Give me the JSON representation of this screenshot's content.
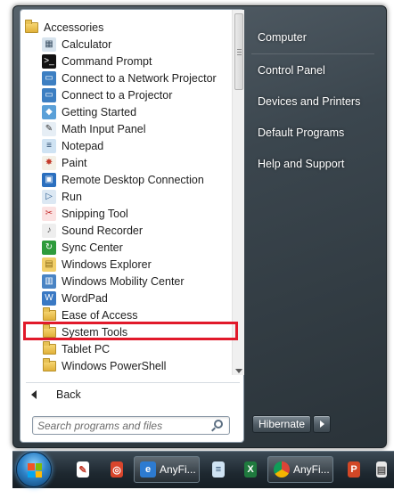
{
  "programs": [
    {
      "label": "Accessories",
      "icon": "folder-icon",
      "root": true
    },
    {
      "label": "Calculator",
      "icon": "calculator-icon"
    },
    {
      "label": "Command Prompt",
      "icon": "command-prompt-icon"
    },
    {
      "label": "Connect to a Network Projector",
      "icon": "network-projector-icon"
    },
    {
      "label": "Connect to a Projector",
      "icon": "projector-icon"
    },
    {
      "label": "Getting Started",
      "icon": "getting-started-icon"
    },
    {
      "label": "Math Input Panel",
      "icon": "math-input-icon"
    },
    {
      "label": "Notepad",
      "icon": "notepad-icon"
    },
    {
      "label": "Paint",
      "icon": "paint-icon"
    },
    {
      "label": "Remote Desktop Connection",
      "icon": "remote-desktop-icon"
    },
    {
      "label": "Run",
      "icon": "run-icon"
    },
    {
      "label": "Snipping Tool",
      "icon": "scissors-icon"
    },
    {
      "label": "Sound Recorder",
      "icon": "microphone-icon"
    },
    {
      "label": "Sync Center",
      "icon": "sync-icon"
    },
    {
      "label": "Windows Explorer",
      "icon": "explorer-icon"
    },
    {
      "label": "Windows Mobility Center",
      "icon": "mobility-center-icon"
    },
    {
      "label": "WordPad",
      "icon": "wordpad-icon"
    },
    {
      "label": "Ease of Access",
      "icon": "folder-icon"
    },
    {
      "label": "System Tools",
      "icon": "folder-icon"
    },
    {
      "label": "Tablet PC",
      "icon": "folder-icon"
    },
    {
      "label": "Windows PowerShell",
      "icon": "folder-icon"
    }
  ],
  "back": {
    "label": "Back"
  },
  "search": {
    "placeholder": "Search programs and files"
  },
  "right_pane": {
    "items": [
      "Computer",
      "Control Panel",
      "Devices and Printers",
      "Default Programs",
      "Help and Support"
    ]
  },
  "power": {
    "hibernate_label": "Hibernate"
  },
  "taskbar": {
    "buttons": [
      {
        "label": "AnyFi...",
        "icon": "ie-icon"
      },
      {
        "label": "AnyFi...",
        "icon": "chrome-icon"
      }
    ]
  },
  "colors": {
    "highlight": "#e1192a",
    "folder": "#e7c154"
  }
}
